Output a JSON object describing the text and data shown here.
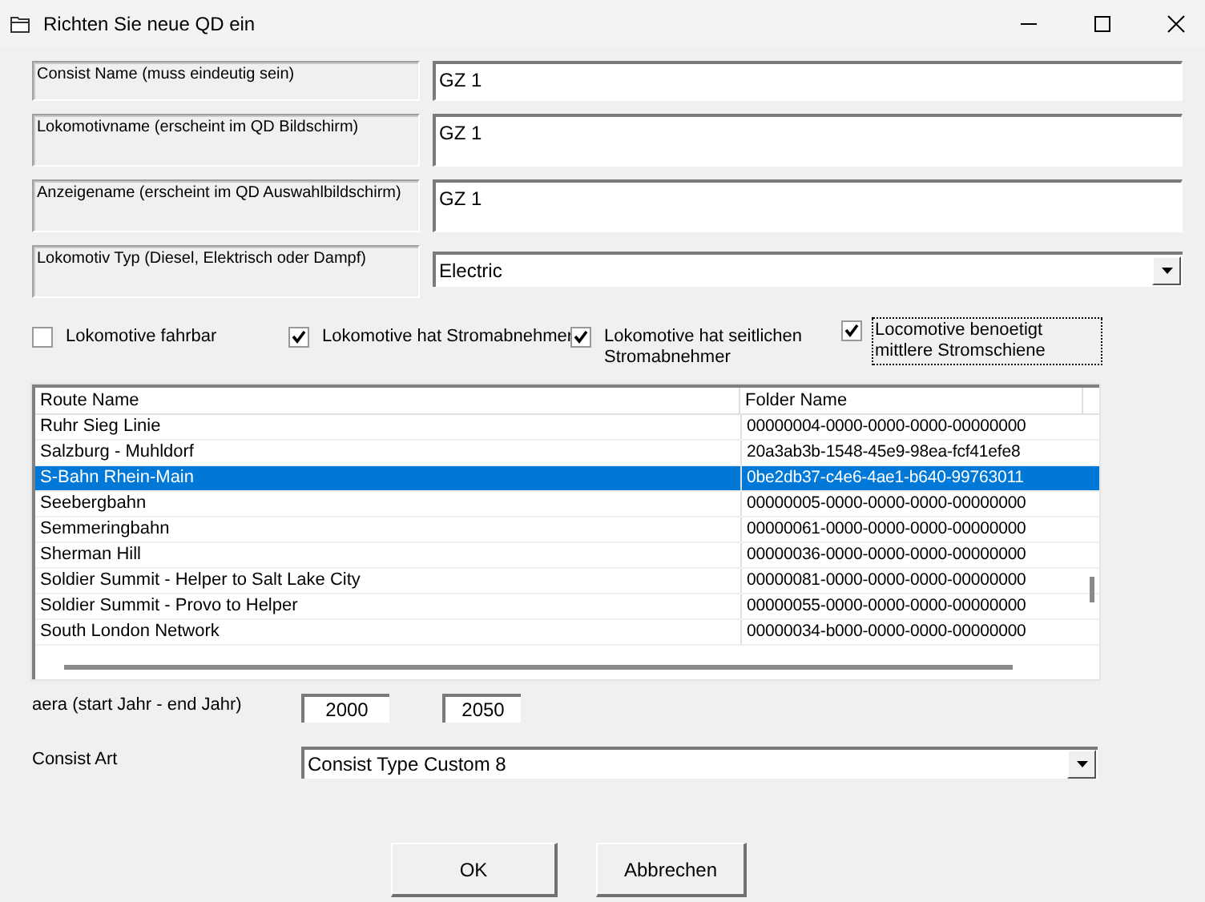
{
  "window": {
    "title": "Richten Sie neue QD ein"
  },
  "fields": [
    {
      "label": "Consist Name (muss eindeutig sein)",
      "value": "GZ 1",
      "kind": "text"
    },
    {
      "label": "Lokomotivname (erscheint im QD Bildschirm)",
      "value": "GZ 1",
      "kind": "multiline"
    },
    {
      "label": "Anzeigename (erscheint im QD Auswahlbildschirm)",
      "value": "GZ 1",
      "kind": "multiline"
    },
    {
      "label": "Lokomotiv Typ (Diesel, Elektrisch oder Dampf)",
      "value": "Electric",
      "kind": "dropdown"
    }
  ],
  "checkboxes": [
    {
      "label": "Lokomotive fahrbar",
      "checked": false,
      "focused": false
    },
    {
      "label": "Lokomotive hat Stromabnehmer",
      "checked": true,
      "focused": false
    },
    {
      "label": "Lokomotive hat seitlichen Stromabnehmer",
      "checked": true,
      "focused": false
    },
    {
      "label": "Locomotive benoetigt mittlere Stromschiene",
      "checked": true,
      "focused": true
    }
  ],
  "table": {
    "columns": [
      "Route Name",
      "Folder Name"
    ],
    "rows": [
      {
        "cells": [
          "Ruhr Sieg Linie",
          "00000004-0000-0000-0000-00000000"
        ],
        "selected": false
      },
      {
        "cells": [
          "Salzburg - Muhldorf",
          "20a3ab3b-1548-45e9-98ea-fcf41efe8"
        ],
        "selected": false
      },
      {
        "cells": [
          "S-Bahn Rhein-Main",
          "0be2db37-c4e6-4ae1-b640-99763011"
        ],
        "selected": true
      },
      {
        "cells": [
          "Seebergbahn",
          "00000005-0000-0000-0000-00000000"
        ],
        "selected": false
      },
      {
        "cells": [
          "Semmeringbahn",
          "00000061-0000-0000-0000-00000000"
        ],
        "selected": false
      },
      {
        "cells": [
          "Sherman Hill",
          "00000036-0000-0000-0000-00000000"
        ],
        "selected": false
      },
      {
        "cells": [
          "Soldier Summit - Helper to Salt Lake City",
          "00000081-0000-0000-0000-00000000"
        ],
        "selected": false
      },
      {
        "cells": [
          "Soldier Summit - Provo to Helper",
          "00000055-0000-0000-0000-00000000"
        ],
        "selected": false
      },
      {
        "cells": [
          "South London Network",
          "00000034-b000-0000-0000-00000000"
        ],
        "selected": false
      }
    ]
  },
  "era": {
    "label": "aera (start Jahr - end Jahr)",
    "start": "2000",
    "end": "2050"
  },
  "consist_art": {
    "label": "Consist Art",
    "value": "Consist Type Custom 8"
  },
  "buttons": [
    "OK",
    "Abbrechen"
  ]
}
